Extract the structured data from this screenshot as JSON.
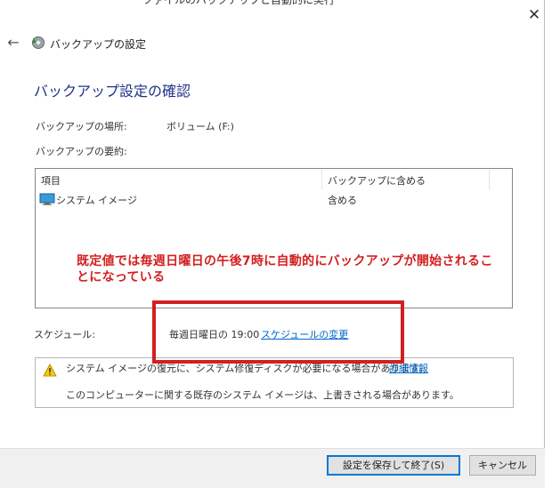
{
  "background": {
    "title_clip": "ファイルのバックアップと自動的に実行"
  },
  "window": {
    "close_glyph": "✕",
    "back_glyph": "←",
    "title": "バックアップの設定",
    "heading": "バックアップ設定の確認"
  },
  "details": {
    "location_label": "バックアップの場所:",
    "location_value": "ボリューム (F:)",
    "summary_label": "バックアップの要約:"
  },
  "summary_table": {
    "headers": [
      "項目",
      "バックアップに含める"
    ],
    "rows": [
      {
        "item": "システム イメージ",
        "included": "含める",
        "icon": "monitor-icon"
      }
    ]
  },
  "annotation": {
    "text": "既定値では毎週日曜日の午後7時に自動的にバックアップが開始されることになっている",
    "color": "#d42020"
  },
  "schedule": {
    "label": "スケジュール:",
    "value": "毎週日曜日の 19:00",
    "change_link": "スケジュールの変更"
  },
  "info": {
    "icon": "warning-icon",
    "line1": "システム イメージの復元に、システム修復ディスクが必要になる場合があります。",
    "line1_link": "詳細情報",
    "line2": "このコンピューターに関する既存のシステム イメージは、上書きされる場合があります。"
  },
  "buttons": {
    "save": "設定を保存して終了(S)",
    "cancel": "キャンセル"
  },
  "colors": {
    "heading": "#1e3287",
    "link": "#0066cc",
    "highlight_box": "#d21f1f",
    "accent_button_border": "#0078d7"
  }
}
